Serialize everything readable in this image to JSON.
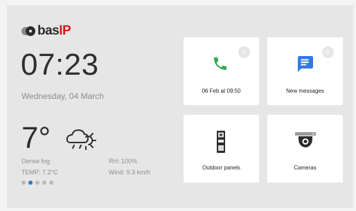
{
  "brand": {
    "name": "bas",
    "suffix": "IP"
  },
  "clock": {
    "time": "07:23",
    "date": "Wednesday, 04 March"
  },
  "weather": {
    "temperature": "7°",
    "condition": "Dense fog",
    "temp_detail": "TEMP: 7.2°C",
    "humidity": "RH: 100%",
    "wind": "Wind: 9.3 km/h",
    "icon": "cloud-sun-icon"
  },
  "pager": {
    "total": 5,
    "active_index": 1
  },
  "tiles": [
    {
      "label": "06 Feb at 09:50",
      "badge": "0",
      "icon": "phone-icon",
      "color": "#33a852"
    },
    {
      "label": "New messages",
      "badge": "0",
      "icon": "message-icon",
      "color": "#3578e5"
    },
    {
      "label": "Outdoor panels",
      "icon": "intercom-panel-icon",
      "color": "#2b2b2b"
    },
    {
      "label": "Cameras",
      "icon": "dome-camera-icon",
      "color": "#2b2b2b"
    }
  ],
  "colors": {
    "background": "#e6e6e6",
    "brand_accent": "#e1141e",
    "pager_active": "#2f78d0"
  }
}
